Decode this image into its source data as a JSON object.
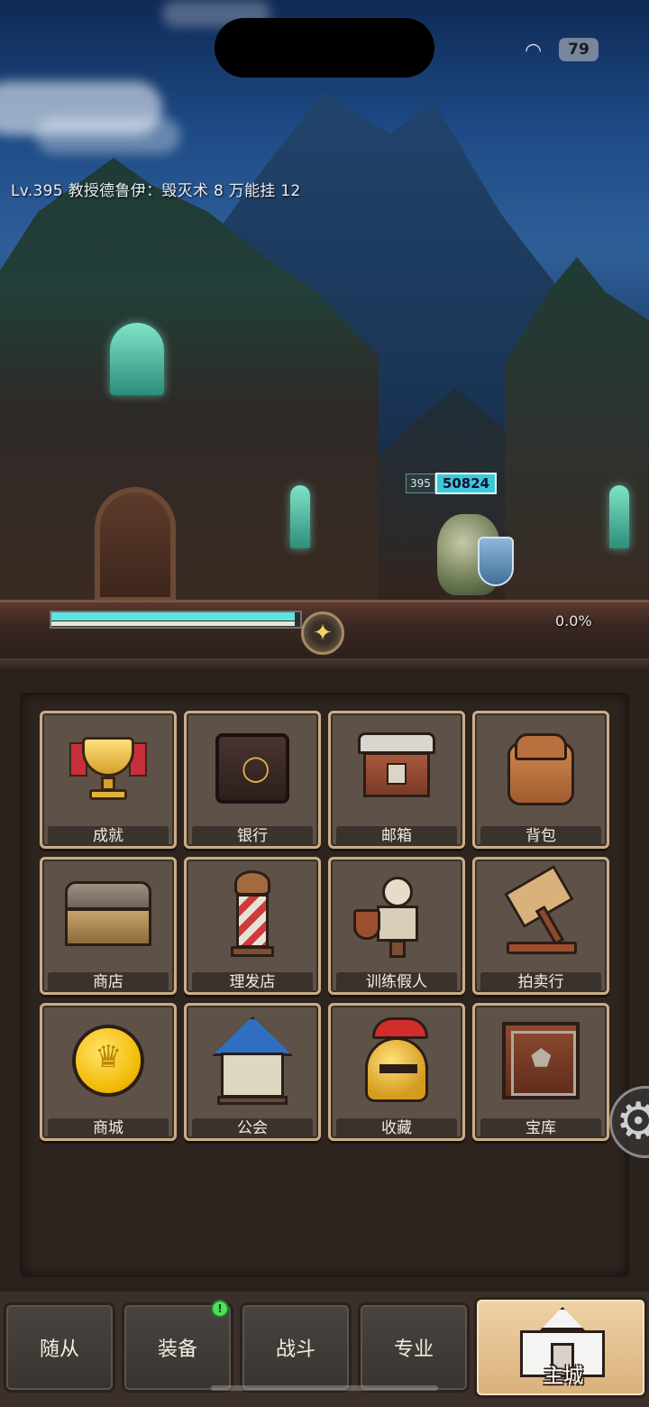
{
  "status_bar": {
    "wifi_icon": "wifi-icon",
    "battery": "79"
  },
  "scene": {
    "level_text": "Lv.395 教授德鲁伊：毁灭术 8 万能挂 12",
    "enemy": {
      "level": "395",
      "hp": "50824"
    },
    "progress": {
      "fill_fraction": 0.98,
      "percent_text": "0.0%"
    }
  },
  "menu": {
    "items": [
      {
        "label": "成就",
        "icon": "trophy-icon"
      },
      {
        "label": "银行",
        "icon": "safe-icon"
      },
      {
        "label": "邮箱",
        "icon": "mailbox-icon"
      },
      {
        "label": "背包",
        "icon": "backpack-icon"
      },
      {
        "label": "商店",
        "icon": "chest-icon"
      },
      {
        "label": "理发店",
        "icon": "barber-pole-icon"
      },
      {
        "label": "训练假人",
        "icon": "training-dummy-icon"
      },
      {
        "label": "拍卖行",
        "icon": "auction-hammer-icon"
      },
      {
        "label": "商城",
        "icon": "gold-coin-icon"
      },
      {
        "label": "公会",
        "icon": "guild-house-icon"
      },
      {
        "label": "收藏",
        "icon": "helmet-icon"
      },
      {
        "label": "宝库",
        "icon": "vault-icon"
      }
    ]
  },
  "nav": {
    "tabs": [
      {
        "label": "随从"
      },
      {
        "label": "装备"
      },
      {
        "label": "战斗"
      },
      {
        "label": "专业"
      },
      {
        "label": "主城"
      }
    ],
    "badge": "!"
  },
  "colors": {
    "accent_cyan": "#5fe3e0",
    "tile_border": "#c9ad86",
    "active_tab": "#e6c08c"
  }
}
